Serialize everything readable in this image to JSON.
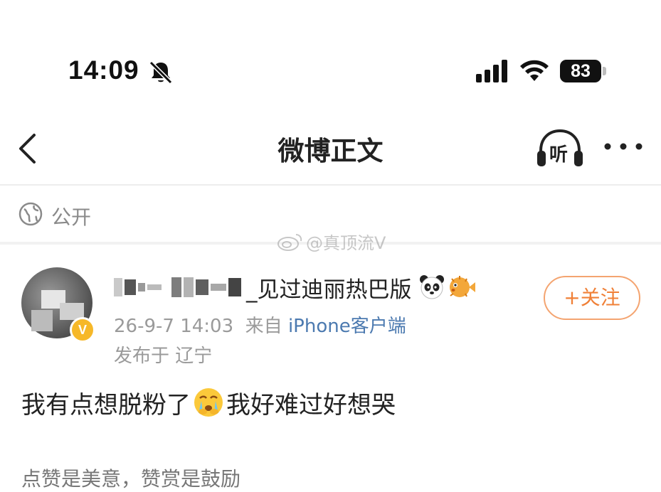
{
  "status": {
    "time": "14:09",
    "battery": "83",
    "icons": [
      "bell-slash-icon",
      "signal-icon",
      "wifi-icon",
      "battery-icon"
    ]
  },
  "nav": {
    "title": "微博正文",
    "listen_label": "听",
    "icons": [
      "back-chevron-icon",
      "headphones-icon",
      "more-dots-icon"
    ]
  },
  "visibility": {
    "label": "公开",
    "icon": "globe-icon"
  },
  "watermark": {
    "text": "@真顶流V",
    "icon": "weibo-logo-icon"
  },
  "post": {
    "username_visible": "_见过迪丽热巴版",
    "username_emojis": [
      "panda-emoji",
      "pufferfish-emoji"
    ],
    "timestamp": "26-9-7 14:03",
    "source_prefix": "来自",
    "source_name": "iPhone客户端",
    "location": "发布于 辽宁",
    "follow_label": "+关注",
    "text_part1": "我有点想脱粉了",
    "text_part2": "我好难过好想哭",
    "inline_emoji": "crying-face-emoji",
    "bottom_partial": "点赞是美意，赞赏是鼓励"
  },
  "colors": {
    "accent_orange": "#f08037",
    "link_blue": "#4c7ab0",
    "verified_gold": "#f6b829",
    "muted_gray": "#9a9a9a"
  }
}
